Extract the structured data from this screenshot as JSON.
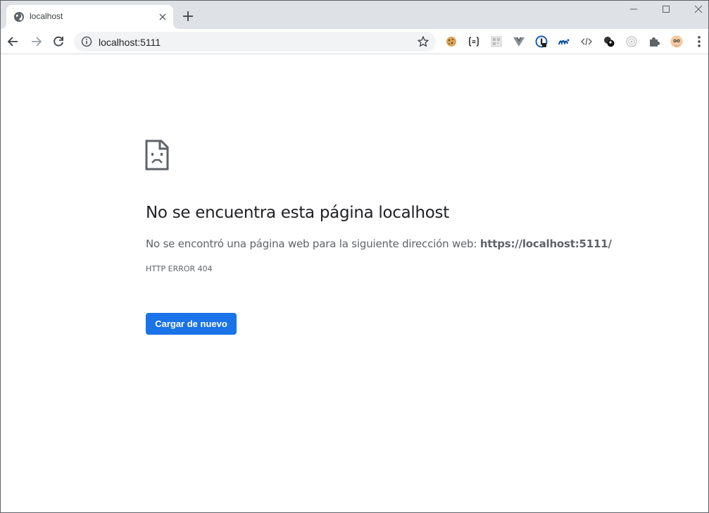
{
  "tab": {
    "title": "localhost",
    "favicon": "globe-icon"
  },
  "toolbar": {
    "url": "localhost:5111",
    "extensions": [
      "cookie-icon",
      "json-icon",
      "qr-icon",
      "vue-icon",
      "onepassword-icon",
      "movistar-icon",
      "code-icon",
      "pool-ball-icon",
      "target-icon",
      "puzzle-icon",
      "avatar"
    ]
  },
  "error": {
    "title": "No se encuentra esta página localhost",
    "description_prefix": "No se encontró una página web para la siguiente dirección web: ",
    "description_url": "https://localhost:5111/",
    "code": "HTTP ERROR 404",
    "reload_label": "Cargar de nuevo"
  },
  "colors": {
    "accent": "#1a73e8",
    "tabstrip": "#dee1e6",
    "omnibox": "#f1f3f4"
  }
}
